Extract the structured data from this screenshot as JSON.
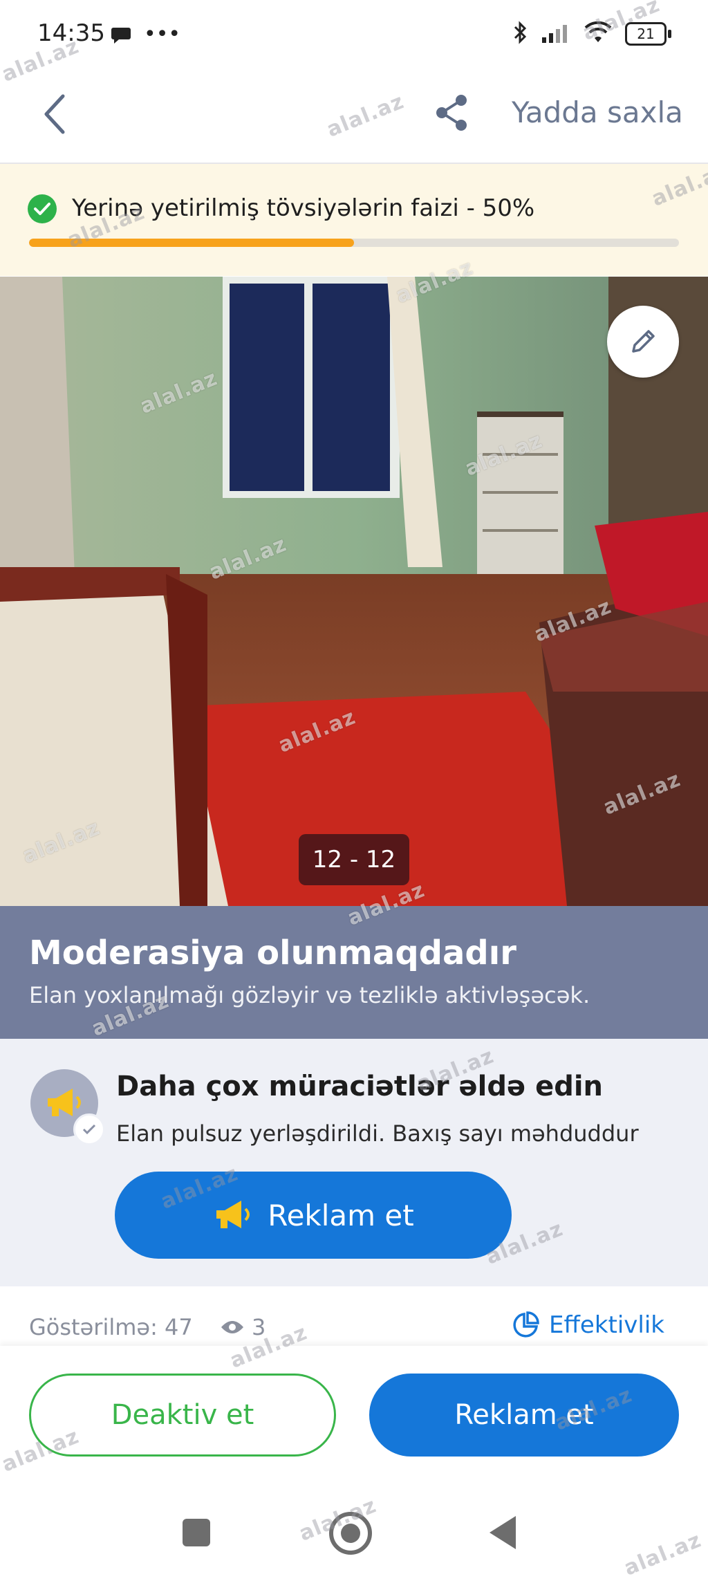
{
  "status_bar": {
    "time": "14:35",
    "battery": "21"
  },
  "header": {
    "save_label": "Yadda saxla"
  },
  "progress": {
    "text": "Yerinə yetirilmiş tövsiyələrin faizi - 50%",
    "fraction": 0.5
  },
  "gallery": {
    "counter": "12 - 12"
  },
  "moderation": {
    "title": "Moderasiya olunmaqdadır",
    "subtitle": "Elan yoxlanılmağı gözləyir və tezliklə aktivləşəcək."
  },
  "promo": {
    "title": "Daha çox müraciətlər əldə edin",
    "subtitle": "Elan pulsuz yerləşdirildi. Baxış sayı məhduddur",
    "button_label": "Reklam et"
  },
  "stats": {
    "views_label": "Göstərilmə: 47",
    "eye_count": "3",
    "effectiveness_label": "Effektivlik"
  },
  "actions": {
    "deactivate_label": "Deaktiv et",
    "advertise_label": "Reklam et"
  },
  "watermark": "alal.az",
  "colors": {
    "accent_blue": "#1577d9",
    "green": "#39b54a",
    "orange": "#f7a21b",
    "banner": "#737d9c"
  }
}
